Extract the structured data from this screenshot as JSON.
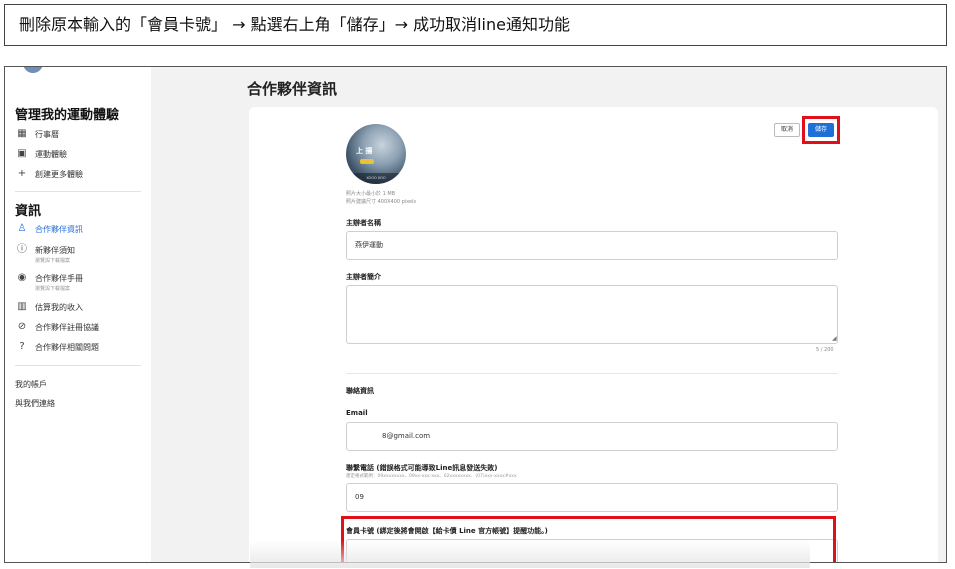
{
  "instruction": "刪除原本輸入的「會員卡號」 → 點選右上角「儲存」→ 成功取消line通知功能",
  "sidebar": {
    "section1_title": "管理我的運動體驗",
    "items1": [
      {
        "icon": "calendar-icon",
        "glyph": "▦",
        "label": "行事曆"
      },
      {
        "icon": "grid-icon",
        "glyph": "▣",
        "label": "運動體驗"
      },
      {
        "icon": "plus-icon",
        "glyph": "+",
        "label": "創建更多體驗"
      }
    ],
    "section2_title": "資訊",
    "items2": [
      {
        "icon": "person-icon",
        "glyph": "♙",
        "label": "合作夥伴資訊",
        "sub": ""
      },
      {
        "icon": "info-icon",
        "glyph": "ⓘ",
        "label": "新夥伴須知",
        "sub": "瀏覽與下載檔案"
      },
      {
        "icon": "eye-icon",
        "glyph": "◉",
        "label": "合作夥伴手冊",
        "sub": "瀏覽與下載檔案"
      },
      {
        "icon": "chart-icon",
        "glyph": "▥",
        "label": "估算我的收入",
        "sub": ""
      },
      {
        "icon": "paperclip-icon",
        "glyph": "⊘",
        "label": "合作夥伴註冊協議",
        "sub": ""
      },
      {
        "icon": "question-icon",
        "glyph": "?",
        "label": "合作夥伴相關問題",
        "sub": ""
      }
    ],
    "my_account": "我的帳戶",
    "contact": "與我們連絡"
  },
  "main": {
    "page_title": "合作夥伴資訊",
    "buttons": {
      "cancel": "取消",
      "save": "儲存"
    },
    "profile": {
      "logo_text": "上 揚",
      "bar_text": "XOOO XOO",
      "note1": "照片大小最小於 1 MB",
      "note2": "照片建議尺寸 400X400 pixels"
    },
    "host_name_label": "主辦者名稱",
    "host_name_value": "燕伊運動",
    "host_intro_label": "主辦者簡介",
    "host_intro_value": "",
    "counter": "5 / 200",
    "contact_section": "聯絡資訊",
    "email_label": "Email",
    "email_value": "8@gmail.com",
    "phone_label": "聯繫電話 (錯誤格式可能導致Line訊息發送失敗)",
    "phone_hint": "建定格式範例：09xxxxxxxx、09xx-xxx-xxx、02xxxxxxxx、(07)xxx-xxxx#xxx",
    "phone_value": "09",
    "card_label": "會員卡號 (綁定後將會開啟【給卡債 Line 官方帳號】提醒功能。)",
    "card_value": "",
    "highlight_color": "#e0101b",
    "accent_color": "#1f6fd9"
  }
}
